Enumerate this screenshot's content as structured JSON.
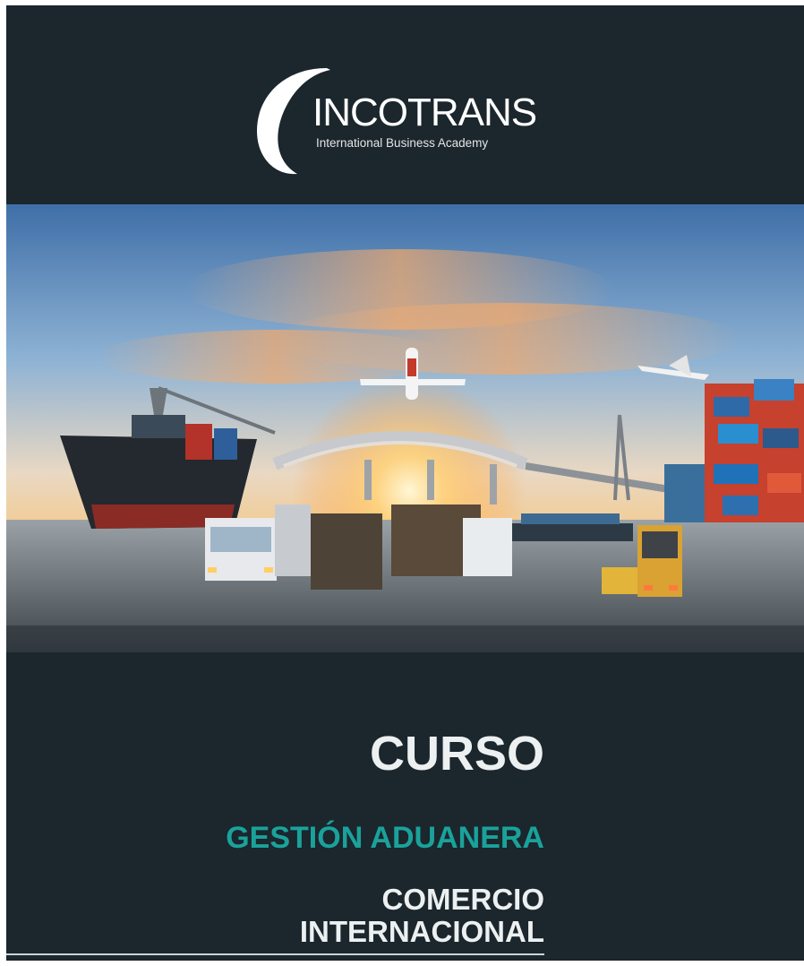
{
  "logo": {
    "brand": "INCOTRANS",
    "tagline": "International Business Academy"
  },
  "hero": {
    "scene": "port-logistics-icon"
  },
  "titles": {
    "course": "CURSO",
    "subject": "GESTIÓN ADUANERA",
    "line1": "COMERCIO",
    "line2": "INTERNACIONAL"
  },
  "colors": {
    "background": "#1b262d",
    "accent": "#1aa29a",
    "text": "#ecf0f1"
  }
}
